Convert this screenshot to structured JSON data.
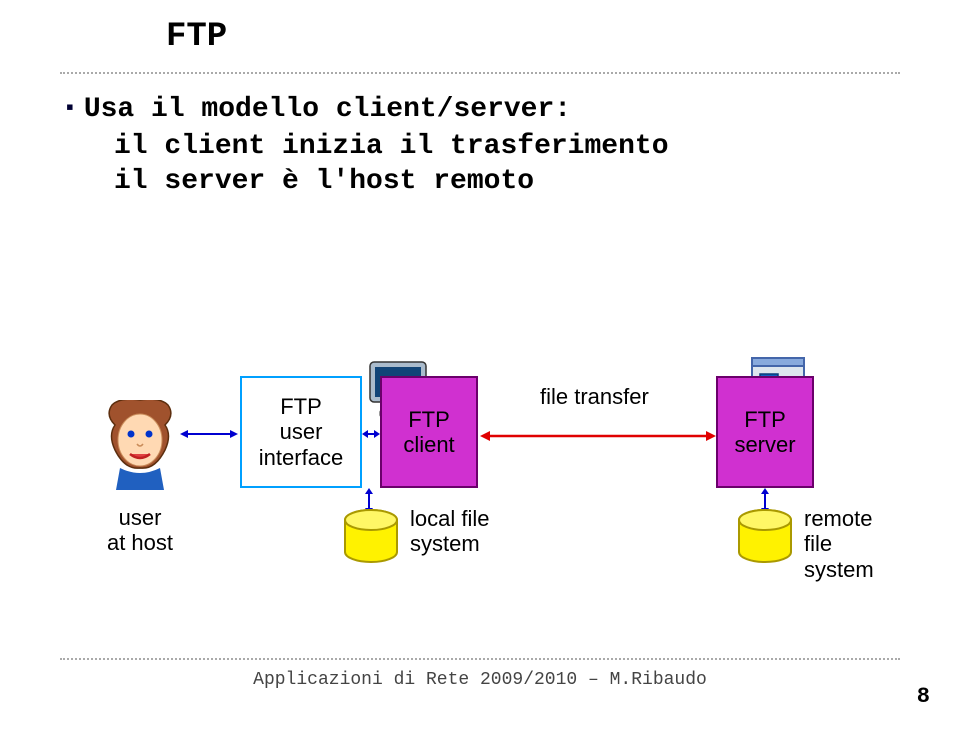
{
  "title": "FTP",
  "bullets": {
    "main": "Usa il modello client/server:",
    "sub1": "il client inizia il trasferimento",
    "sub2": "il server è l'host remoto"
  },
  "diagram": {
    "user_at_host": "user\nat host",
    "ftp_ui": "FTP\nuser\ninterface",
    "ftp_client": "FTP\nclient",
    "local_fs": "local file\nsystem",
    "file_transfer": "file transfer",
    "ftp_server": "FTP\nserver",
    "remote_fs": "remote file\nsystem"
  },
  "footer": "Applicazioni di Rete 2009/2010 – M.Ribaudo",
  "page": "8",
  "colors": {
    "box_purple": "#D030D0",
    "box_blue": "#00A0FF",
    "arrow_red": "#E00000",
    "arrow_blue": "#0000D0",
    "cyl_yellow": "#FFF200"
  }
}
